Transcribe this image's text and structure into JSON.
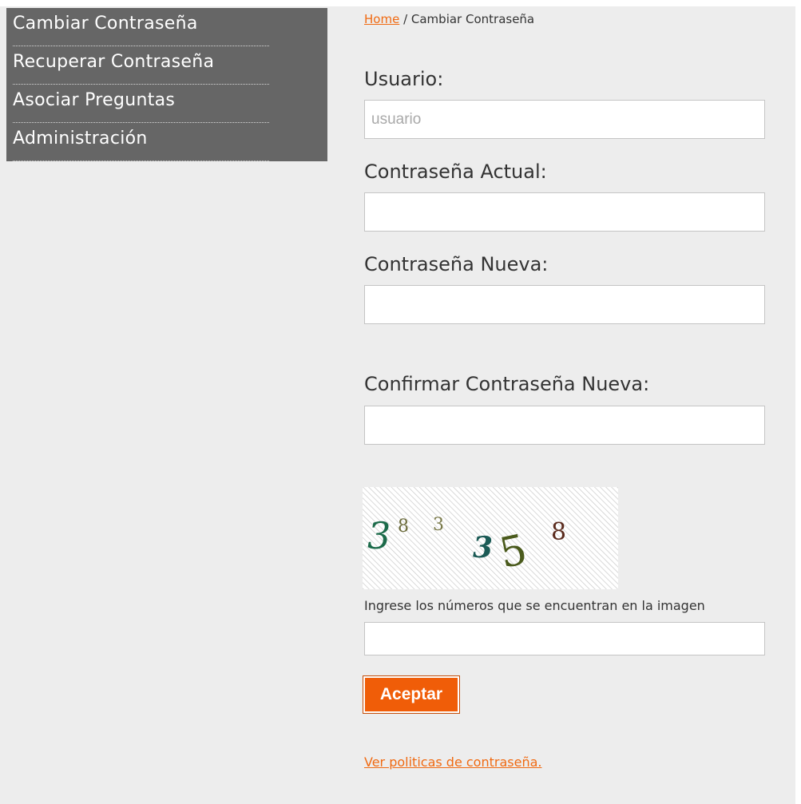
{
  "menu": {
    "items": [
      {
        "label": "Cambiar Contraseña"
      },
      {
        "label": "Recuperar Contraseña"
      },
      {
        "label": "Asociar Preguntas"
      },
      {
        "label": "Administración"
      }
    ]
  },
  "breadcrumb": {
    "home": "Home",
    "separator": " / ",
    "current": "Cambiar Contraseña"
  },
  "form": {
    "user_label": "Usuario:",
    "user_placeholder": "usuario",
    "current_password_label": "Contraseña Actual:",
    "new_password_label": "Contraseña Nueva:",
    "confirm_password_label": "Confirmar Contraseña Nueva:",
    "captcha_hint": "Ingrese los números que se encuentran en la imagen",
    "submit_label": "Aceptar",
    "policy_link": "Ver politicas de contraseña."
  },
  "captcha": {
    "digits": [
      "3",
      "8",
      "3",
      "3",
      "5",
      "8"
    ],
    "colors": [
      "#1c6b4a",
      "#6b6b3a",
      "#7a7a4a",
      "#1c5b56",
      "#4a5a1c",
      "#5a2a1c"
    ]
  },
  "colors": {
    "accent": "#f05d08",
    "link": "#f06a12",
    "sidebar_bg": "#666666",
    "page_bg": "#ededed"
  }
}
